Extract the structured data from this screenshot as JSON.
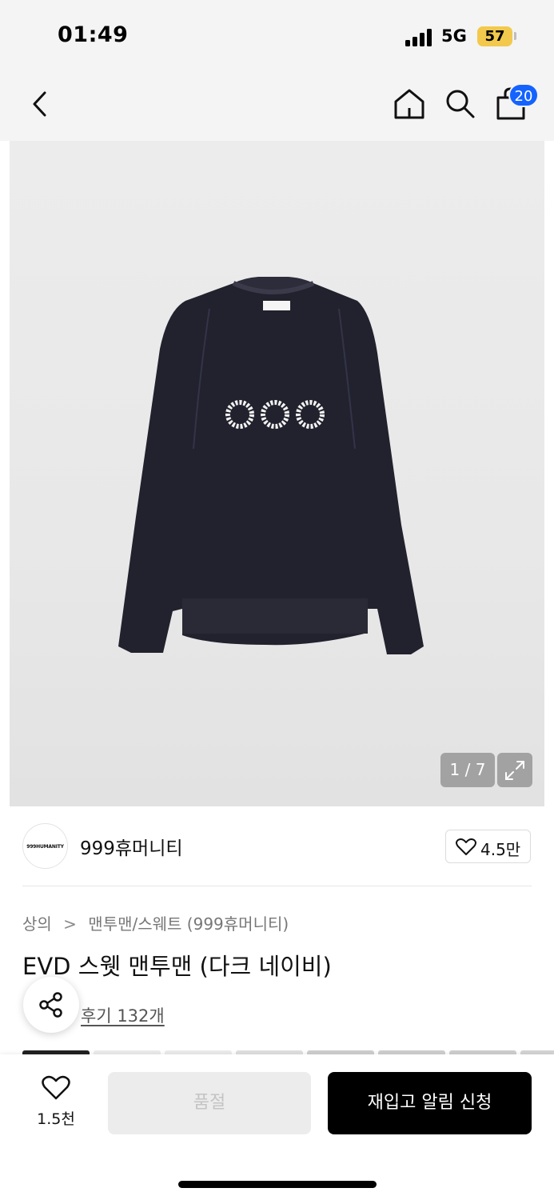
{
  "status_bar": {
    "time": "01:49",
    "network": "5G",
    "battery": "57"
  },
  "nav": {
    "cart_count": "20",
    "icons": [
      "chevron-left-icon",
      "home-icon",
      "search-icon",
      "shopping-bag-icon"
    ]
  },
  "product_image": {
    "counter": "1 / 7",
    "brand_mark": "999HUMANITY",
    "colors": {
      "garment": "#22222e",
      "embroidery": "#f2f2f2"
    }
  },
  "brand": {
    "logo_text": "999HUMANITY",
    "name": "999휴머니티",
    "like_count": "4.5만"
  },
  "breadcrumb": {
    "category": "상의",
    "subcategory": "맨투맨/스웨트 (999휴머니티)"
  },
  "product": {
    "title": "EVD 스웻 맨투맨 (다크 네이비)",
    "reviews": "후기 132개"
  },
  "bottom_bar": {
    "wish_count": "1.5천",
    "soldout_label": "품절",
    "restock_label": "재입고 알림 신청"
  },
  "colors": {
    "accent": "#1463ff",
    "primary_button": "#000000",
    "disabled_button": "#ececec"
  }
}
